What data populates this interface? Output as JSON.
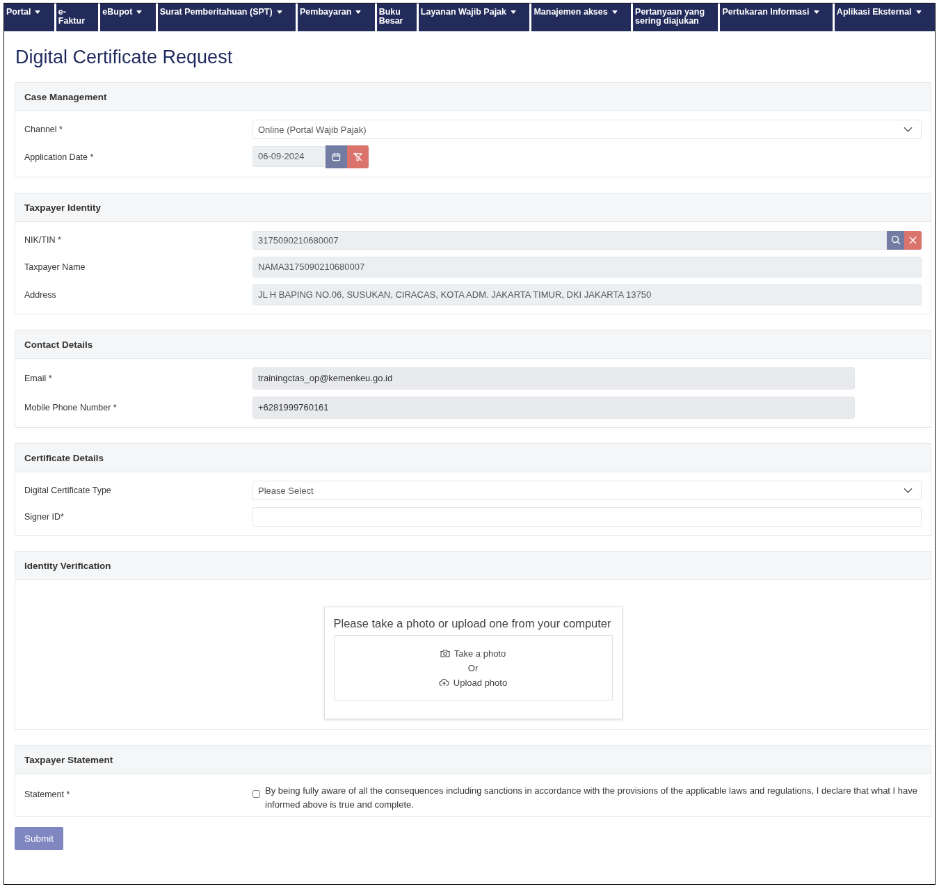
{
  "nav": [
    {
      "lines": [
        "Portal"
      ],
      "dropdown": true
    },
    {
      "lines": [
        "e-",
        "Faktur"
      ],
      "dropdown": false
    },
    {
      "lines": [
        "eBupot"
      ],
      "dropdown": true
    },
    {
      "lines": [
        "Surat Pemberitahuan (SPT)"
      ],
      "dropdown": true
    },
    {
      "lines": [
        "Pembayaran"
      ],
      "dropdown": true
    },
    {
      "lines": [
        "Buku",
        "Besar"
      ],
      "dropdown": false
    },
    {
      "lines": [
        "Layanan Wajib Pajak"
      ],
      "dropdown": true
    },
    {
      "lines": [
        "Manajemen akses"
      ],
      "dropdown": true
    },
    {
      "lines": [
        "Pertanyaan yang",
        "sering diajukan"
      ],
      "dropdown": false
    },
    {
      "lines": [
        "Pertukaran Informasi"
      ],
      "dropdown": true
    },
    {
      "lines": [
        "Aplikasi Eksternal"
      ],
      "dropdown": true
    }
  ],
  "title": "Digital Certificate Request",
  "sections": [
    {
      "kind": "form",
      "title": "Case Management",
      "fields": [
        {
          "label": "Channel *",
          "kind": "select",
          "value": "Online (Portal Wajib Pajak)"
        },
        {
          "label": "Application Date *",
          "kind": "date",
          "value": "06-09-2024"
        }
      ]
    },
    {
      "kind": "form",
      "title": "Taxpayer Identity",
      "fields": [
        {
          "label": "NIK/TIN *",
          "kind": "lookup",
          "value": "3175090210680007"
        },
        {
          "label": "Taxpayer Name",
          "kind": "readonly",
          "value": "NAMA3175090210680007"
        },
        {
          "label": "Address",
          "kind": "readonly",
          "value": "JL H BAPING NO.06, SUSUKAN, CIRACAS, KOTA ADM. JAKARTA TIMUR, DKI JAKARTA 13750"
        }
      ]
    },
    {
      "kind": "form",
      "title": "Contact Details",
      "fields": [
        {
          "label": "Email  *",
          "kind": "short",
          "value": "trainingctas_op@kemenkeu.go.id"
        },
        {
          "label": "Mobile Phone Number  *",
          "kind": "short",
          "value": "+6281999760161"
        }
      ]
    },
    {
      "kind": "form",
      "title": "Certificate Details",
      "fields": [
        {
          "label": "Digital Certificate Type",
          "kind": "select",
          "placeholder": "Please Select"
        },
        {
          "label": "Signer ID*",
          "kind": "input"
        }
      ]
    },
    {
      "kind": "upload",
      "title": "Identity Verification",
      "prompt": "Please take a photo or upload one from your computer",
      "take": "Take a photo",
      "or": "Or",
      "upload": "Upload photo"
    },
    {
      "kind": "statement",
      "title": "Taxpayer Statement",
      "label": "Statement *",
      "checked": false,
      "text": "By being fully aware of all the consequences including sanctions in accordance with the provisions of the applicable laws and regulations, I declare that what I have informed above is true and complete."
    }
  ],
  "submit": "Submit"
}
